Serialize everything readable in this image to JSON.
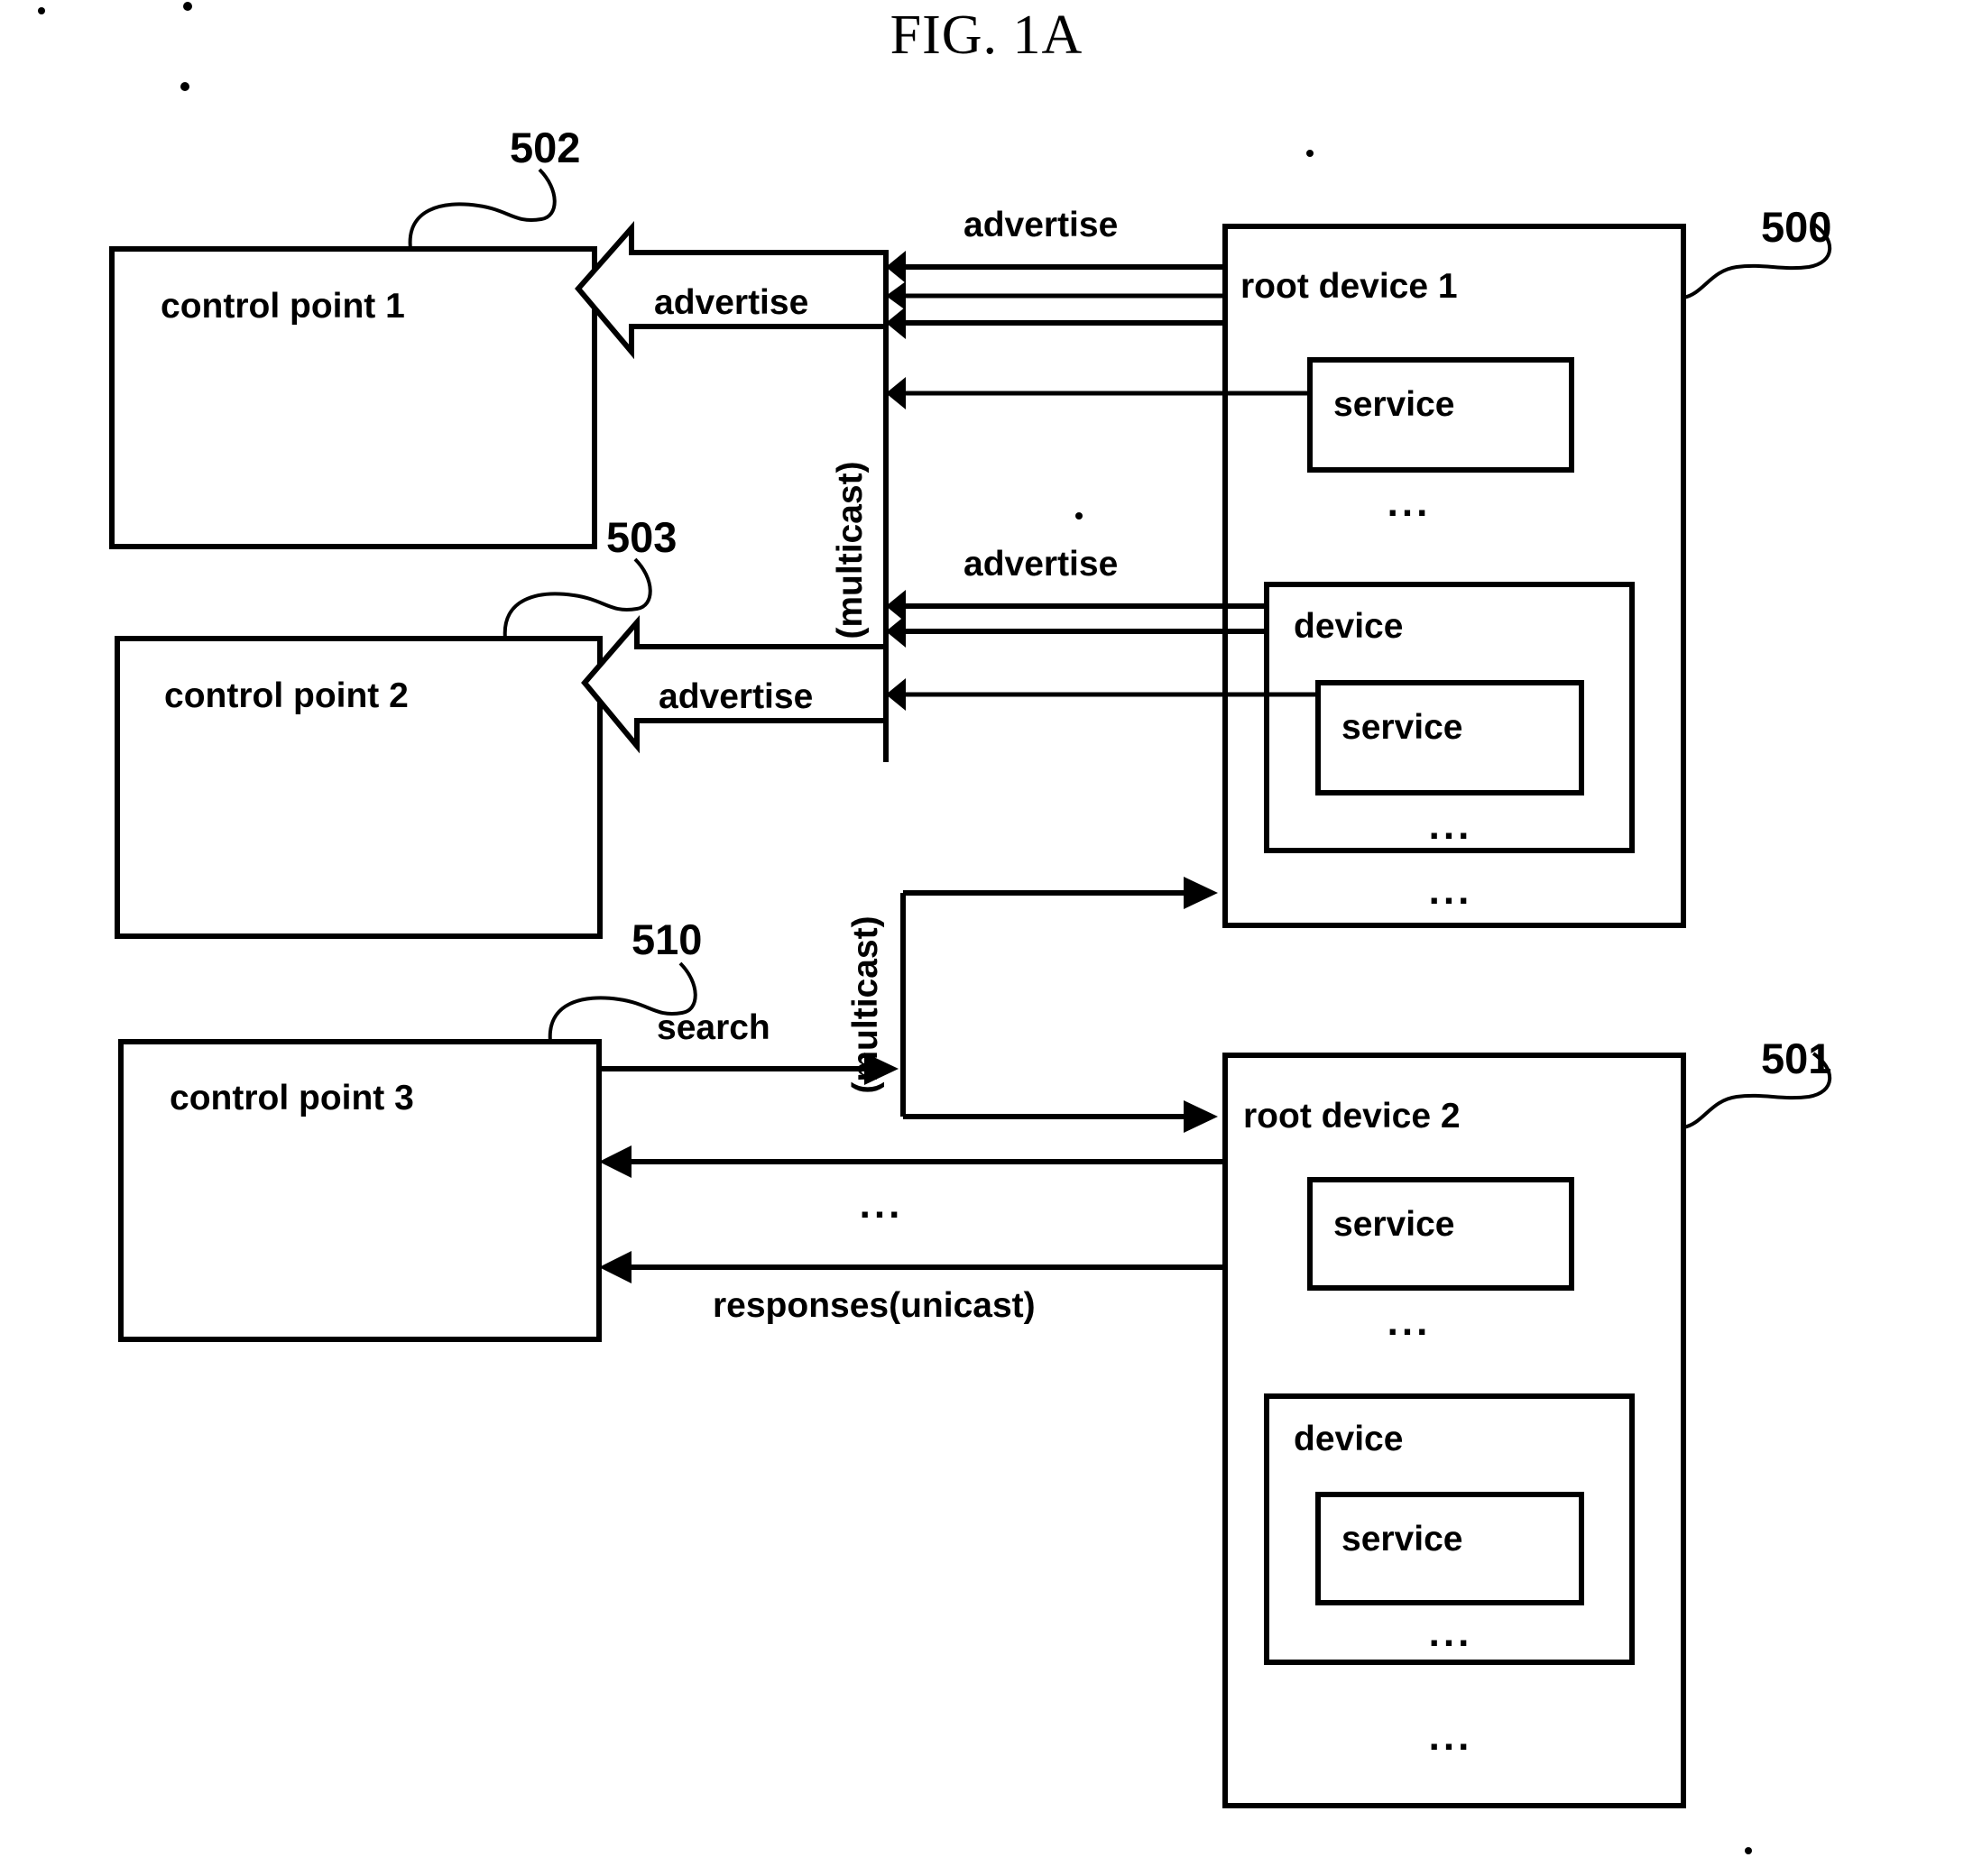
{
  "figure": {
    "title": "FIG. 1A"
  },
  "nodes": {
    "control_point_1": {
      "label": "control point 1",
      "ref": "502"
    },
    "control_point_2": {
      "label": "control point 2",
      "ref": "503"
    },
    "control_point_3": {
      "label": "control point 3",
      "ref": "510"
    },
    "root_device_1": {
      "label": "root device 1",
      "ref": "500"
    },
    "root_device_2": {
      "label": "root device 2",
      "ref": "501"
    },
    "rd1_service": {
      "label": "service"
    },
    "rd1_device": {
      "label": "device"
    },
    "rd1_device_service": {
      "label": "service"
    },
    "rd2_service": {
      "label": "service"
    },
    "rd2_device": {
      "label": "device"
    },
    "rd2_device_service": {
      "label": "service"
    }
  },
  "flows": {
    "advertise_top_bus": "advertise",
    "advertise_to_cp1": "advertise",
    "advertise_mid_bus": "advertise",
    "advertise_to_cp2": "advertise",
    "search": "search",
    "responses": "responses(unicast)"
  },
  "buses": {
    "multicast_upper": "(multicast)",
    "multicast_lower": "(multicast)"
  },
  "ellipses": {
    "rd1_after_service": "...",
    "rd1_device_after_service": "...",
    "rd1_after_device": "...",
    "cp3_responses_gap": "...",
    "rd2_after_service": "...",
    "rd2_device_after_service": "...",
    "rd2_after_device": "..."
  },
  "colors": {
    "ink": "#000000",
    "paper": "#ffffff"
  }
}
